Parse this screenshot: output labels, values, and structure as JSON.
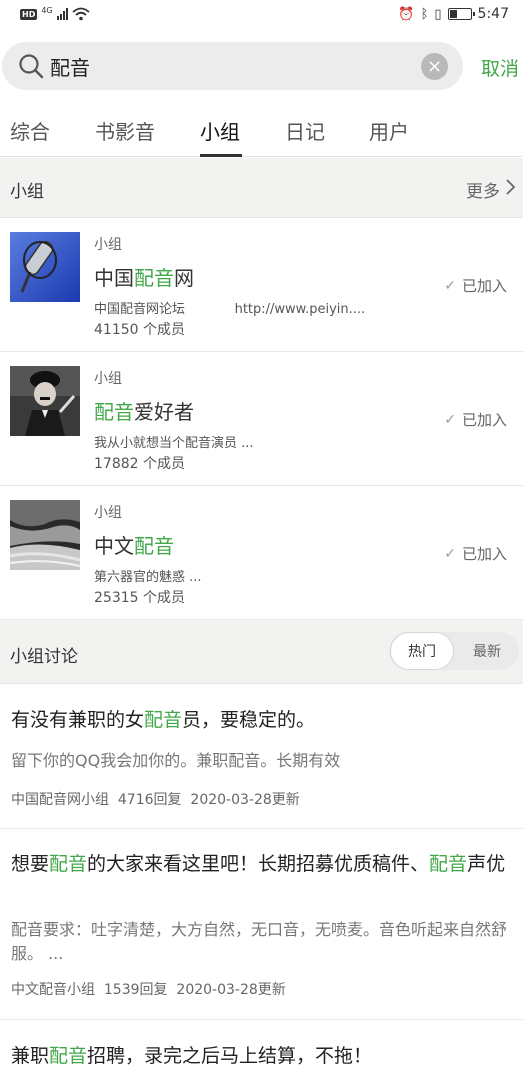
{
  "status_bar": {
    "hd": "HD",
    "network": "4G",
    "time": "5:47",
    "battery_level": 0.35
  },
  "search": {
    "query": "配音",
    "cancel_label": "取消"
  },
  "tabs": [
    {
      "label": "综合"
    },
    {
      "label": "书影音"
    },
    {
      "label": "小组",
      "active": true
    },
    {
      "label": "日记"
    },
    {
      "label": "用户"
    }
  ],
  "groups_section": {
    "title": "小组",
    "more_label": "更多"
  },
  "groups": [
    {
      "kind": "小组",
      "name_pre": "中国",
      "name_hl": "配音",
      "name_post": "网",
      "desc": "中国配音网论坛            http://www.peiyin....",
      "members": "41150 个成员",
      "status": "已加入",
      "thumb_icon": "microphone-image"
    },
    {
      "kind": "小组",
      "name_pre": "",
      "name_hl": "配音",
      "name_post": "爱好者",
      "desc": "我从小就想当个配音演员 ...",
      "members": "17882 个成员",
      "status": "已加入",
      "thumb_icon": "chaplin-photo"
    },
    {
      "kind": "小组",
      "name_pre": "中文",
      "name_hl": "配音",
      "name_post": "",
      "desc": "第六器官的魅惑 ...",
      "members": "25315 个成员",
      "status": "已加入",
      "thumb_icon": "bw-landscape-photo"
    }
  ],
  "discussion_section": {
    "title": "小组讨论",
    "hot_label": "热门",
    "new_label": "最新"
  },
  "discussions": [
    {
      "t1": "有没有兼职的女",
      "t2": "配音",
      "t3": "员，要稳定的。",
      "t4": "",
      "t5": "",
      "body": "留下你的QQ我会加你的。兼职配音。长期有效",
      "meta": "中国配音网小组  4716回复  2020-03-28更新"
    },
    {
      "t1": "想要",
      "t2": "配音",
      "t3": "的大家来看这里吧！长期招募优质稿件、",
      "t4": "配音",
      "t5": "声优",
      "body": "配音要求：吐字清楚，大方自然，无口音，无喷麦。音色听起来自然舒服。 ...",
      "meta": "中文配音小组  1539回复  2020-03-28更新"
    },
    {
      "t1": "兼职",
      "t2": "配音",
      "t3": "招聘，录完之后马上结算，不拖！",
      "t4": "",
      "t5": "",
      "body": "",
      "meta": ""
    }
  ],
  "colors": {
    "accent": "#42a849",
    "section_bg": "#f2f2f0"
  }
}
